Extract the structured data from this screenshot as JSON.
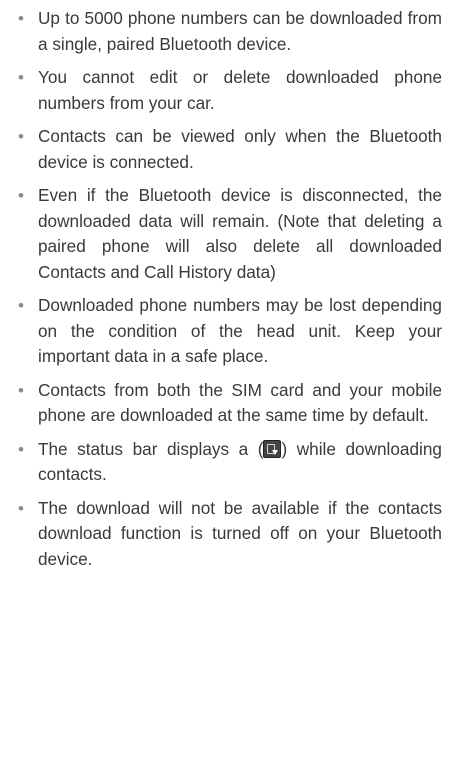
{
  "notes": {
    "items": [
      "Up to 5000 phone numbers can be downloaded from a single, paired Bluetooth device.",
      "You cannot edit or delete downloaded phone numbers from your car.",
      "Contacts can be viewed only when the Bluetooth device is connected.",
      "Even if the Bluetooth device is disconnected, the downloaded data will remain. (Note that deleting a paired phone will also delete all downloaded Contacts and Call History data)",
      "Downloaded phone numbers may be lost depending on the condition of the head unit. Keep your important data in a safe place.",
      "Contacts from both the SIM card and your mobile phone are downloaded at the same time by default.",
      {
        "before": "The status bar displays a (",
        "icon": "contacts-download-icon",
        "after": ") while downloading contacts."
      },
      "The download will not be available if the contacts download function is turned off on your Bluetooth device."
    ]
  },
  "bullet_char": "•"
}
